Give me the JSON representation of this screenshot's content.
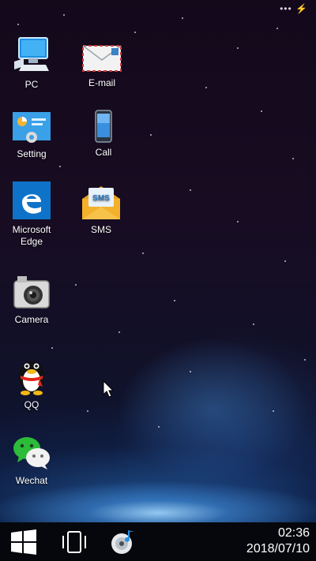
{
  "desktop": {
    "icons": [
      {
        "id": "pc",
        "label": "PC",
        "icon": "computer-icon"
      },
      {
        "id": "email",
        "label": "E-mail",
        "icon": "envelope-icon"
      },
      {
        "id": "setting",
        "label": "Setting",
        "icon": "settings-icon"
      },
      {
        "id": "call",
        "label": "Call",
        "icon": "phone-icon"
      },
      {
        "id": "edge",
        "label": "Microsoft Edge",
        "icon": "edge-browser-icon"
      },
      {
        "id": "sms",
        "label": "SMS",
        "icon": "sms-envelope-icon",
        "badge_text": "SMS"
      },
      {
        "id": "camera",
        "label": "Camera",
        "icon": "camera-icon"
      },
      {
        "id": "qq",
        "label": "QQ",
        "icon": "qq-penguin-icon"
      },
      {
        "id": "wechat",
        "label": "Wechat",
        "icon": "wechat-icon"
      }
    ]
  },
  "taskbar": {
    "start_icon": "windows-start-icon",
    "task_view_icon": "task-view-icon",
    "media_icon": "music-disc-icon",
    "time": "02:36",
    "date": "2018/07/10"
  },
  "colors": {
    "taskbar_bg": "#06070c",
    "edge_blue": "#0e73c8",
    "wechat_green": "#2dbb3a"
  }
}
